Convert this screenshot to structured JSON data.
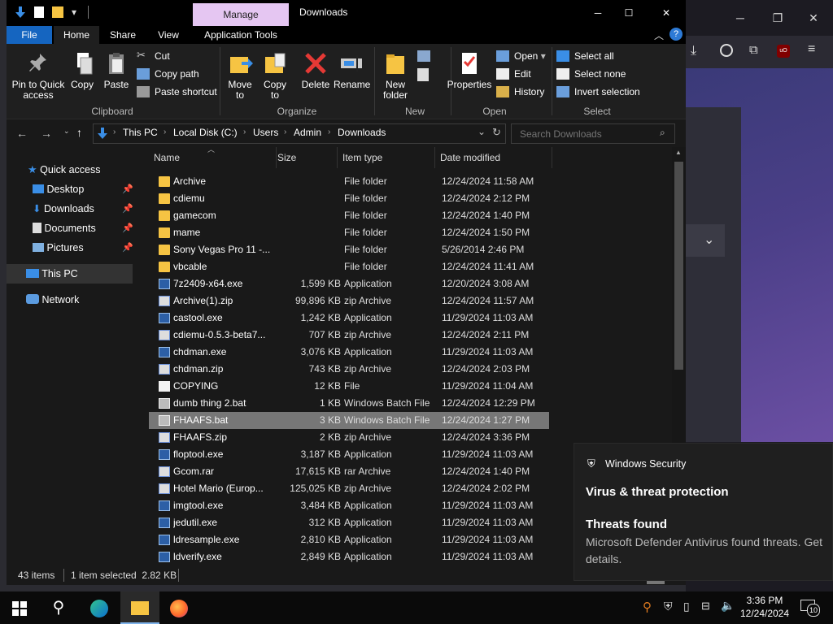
{
  "window": {
    "title": "Downloads",
    "context_tab": "Manage",
    "controls": {
      "minimize": "─",
      "maximize": "☐",
      "close": "✕"
    }
  },
  "qat": {
    "dropdown": "▾"
  },
  "ribbon_tabs": [
    "File",
    "Home",
    "Share",
    "View",
    "Application Tools"
  ],
  "ribbon": {
    "clipboard": {
      "pin": "Pin to Quick access",
      "copy": "Copy",
      "paste": "Paste",
      "cut": "Cut",
      "copy_path": "Copy path",
      "paste_shortcut": "Paste shortcut",
      "label": "Clipboard"
    },
    "organize": {
      "move_to": "Move to",
      "copy_to": "Copy to",
      "delete": "Delete",
      "rename": "Rename",
      "label": "Organize"
    },
    "new": {
      "new_folder": "New folder",
      "label": "New"
    },
    "open": {
      "properties": "Properties",
      "open": "Open",
      "edit": "Edit",
      "history": "History",
      "label": "Open"
    },
    "select": {
      "select_all": "Select all",
      "select_none": "Select none",
      "invert": "Invert selection",
      "label": "Select"
    }
  },
  "address": {
    "crumbs": [
      "This PC",
      "Local Disk (C:)",
      "Users",
      "Admin",
      "Downloads"
    ],
    "search_placeholder": "Search Downloads"
  },
  "nav": {
    "quick_access": "Quick access",
    "items": [
      "Desktop",
      "Downloads",
      "Documents",
      "Pictures"
    ],
    "this_pc": "This PC",
    "network": "Network"
  },
  "columns": [
    "Name",
    "Size",
    "Item type",
    "Date modified"
  ],
  "files": [
    {
      "name": "Archive",
      "size": "",
      "type": "File folder",
      "date": "12/24/2024 11:58 AM",
      "icon": "folder"
    },
    {
      "name": "cdiemu",
      "size": "",
      "type": "File folder",
      "date": "12/24/2024 2:12 PM",
      "icon": "folder"
    },
    {
      "name": "gamecom",
      "size": "",
      "type": "File folder",
      "date": "12/24/2024 1:40 PM",
      "icon": "folder"
    },
    {
      "name": "mame",
      "size": "",
      "type": "File folder",
      "date": "12/24/2024 1:50 PM",
      "icon": "folder"
    },
    {
      "name": "Sony Vegas Pro 11 -...",
      "size": "",
      "type": "File folder",
      "date": "5/26/2014 2:46 PM",
      "icon": "folder"
    },
    {
      "name": "vbcable",
      "size": "",
      "type": "File folder",
      "date": "12/24/2024 11:41 AM",
      "icon": "folder"
    },
    {
      "name": "7z2409-x64.exe",
      "size": "1,599 KB",
      "type": "Application",
      "date": "12/20/2024 3:08 AM",
      "icon": "app"
    },
    {
      "name": "Archive(1).zip",
      "size": "99,896 KB",
      "type": "zip Archive",
      "date": "12/24/2024 11:57 AM",
      "icon": "zip"
    },
    {
      "name": "castool.exe",
      "size": "1,242 KB",
      "type": "Application",
      "date": "11/29/2024 11:03 AM",
      "icon": "app"
    },
    {
      "name": "cdiemu-0.5.3-beta7...",
      "size": "707 KB",
      "type": "zip Archive",
      "date": "12/24/2024 2:11 PM",
      "icon": "zip"
    },
    {
      "name": "chdman.exe",
      "size": "3,076 KB",
      "type": "Application",
      "date": "11/29/2024 11:03 AM",
      "icon": "app"
    },
    {
      "name": "chdman.zip",
      "size": "743 KB",
      "type": "zip Archive",
      "date": "12/24/2024 2:03 PM",
      "icon": "zip"
    },
    {
      "name": "COPYING",
      "size": "12 KB",
      "type": "File",
      "date": "11/29/2024 11:04 AM",
      "icon": "doc"
    },
    {
      "name": "dumb thing 2.bat",
      "size": "1 KB",
      "type": "Windows Batch File",
      "date": "12/24/2024 12:29 PM",
      "icon": "bat"
    },
    {
      "name": "FHAAFS.bat",
      "size": "3 KB",
      "type": "Windows Batch File",
      "date": "12/24/2024 1:27 PM",
      "icon": "bat",
      "selected": true
    },
    {
      "name": "FHAAFS.zip",
      "size": "2 KB",
      "type": "zip Archive",
      "date": "12/24/2024 3:36 PM",
      "icon": "zip"
    },
    {
      "name": "floptool.exe",
      "size": "3,187 KB",
      "type": "Application",
      "date": "11/29/2024 11:03 AM",
      "icon": "app"
    },
    {
      "name": "Gcom.rar",
      "size": "17,615 KB",
      "type": "rar Archive",
      "date": "12/24/2024 1:40 PM",
      "icon": "zip"
    },
    {
      "name": "Hotel Mario (Europ...",
      "size": "125,025 KB",
      "type": "zip Archive",
      "date": "12/24/2024 2:02 PM",
      "icon": "zip"
    },
    {
      "name": "imgtool.exe",
      "size": "3,484 KB",
      "type": "Application",
      "date": "11/29/2024 11:03 AM",
      "icon": "app"
    },
    {
      "name": "jedutil.exe",
      "size": "312 KB",
      "type": "Application",
      "date": "11/29/2024 11:03 AM",
      "icon": "app"
    },
    {
      "name": "ldresample.exe",
      "size": "2,810 KB",
      "type": "Application",
      "date": "11/29/2024 11:03 AM",
      "icon": "app"
    },
    {
      "name": "ldverify.exe",
      "size": "2,849 KB",
      "type": "Application",
      "date": "11/29/2024 11:03 AM",
      "icon": "app"
    }
  ],
  "status": {
    "count": "43 items",
    "selection": "1 item selected  2.82 KB"
  },
  "toast": {
    "app": "Windows Security",
    "heading": "Virus & threat protection",
    "title": "Threats found",
    "body": "Microsoft Defender Antivirus found threats. Get details."
  },
  "taskbar": {
    "time": "3:36 PM",
    "date": "12/24/2024",
    "notif_count": "10"
  },
  "colors": {
    "accent": "#0a64c8",
    "manage_tab": "#e5c6f2",
    "selected_row": "#777777",
    "folder": "#f6c443"
  }
}
